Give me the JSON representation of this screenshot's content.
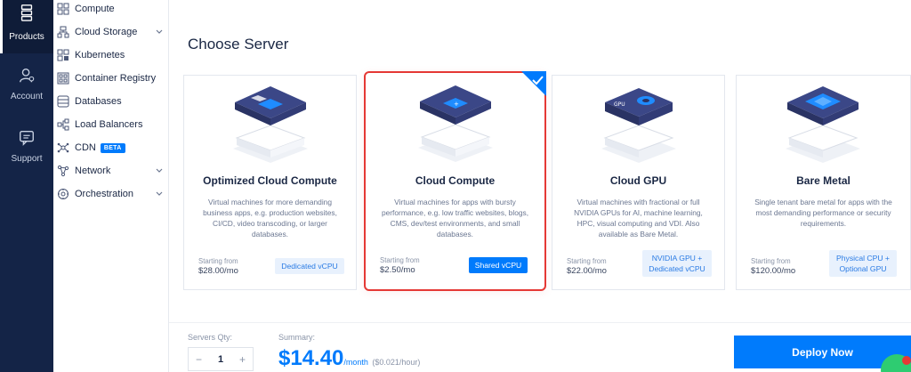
{
  "rail": {
    "items": [
      {
        "label": "Products",
        "icon": "servers-icon",
        "active": true
      },
      {
        "label": "Account",
        "icon": "user-icon",
        "active": false
      },
      {
        "label": "Support",
        "icon": "chat-icon",
        "active": false
      }
    ]
  },
  "submenu": {
    "items": [
      {
        "label": "Compute",
        "icon": "compute-icon",
        "chevron": false
      },
      {
        "label": "Cloud Storage",
        "icon": "cloud-storage-icon",
        "chevron": true
      },
      {
        "label": "Kubernetes",
        "icon": "kubernetes-icon",
        "chevron": false
      },
      {
        "label": "Container Registry",
        "icon": "container-registry-icon",
        "chevron": false
      },
      {
        "label": "Databases",
        "icon": "databases-icon",
        "chevron": false
      },
      {
        "label": "Load Balancers",
        "icon": "load-balancers-icon",
        "chevron": false
      },
      {
        "label": "CDN",
        "icon": "cdn-icon",
        "chevron": false,
        "badge": "BETA"
      },
      {
        "label": "Network",
        "icon": "network-icon",
        "chevron": true
      },
      {
        "label": "Orchestration",
        "icon": "orchestration-icon",
        "chevron": true
      }
    ]
  },
  "main": {
    "title": "Choose Server",
    "cards": [
      {
        "name": "Optimized Cloud Compute",
        "description": "Virtual machines for more demanding business apps, e.g. production websites, CI/CD, video transcoding, or larger databases.",
        "starting_from": "Starting from",
        "price": "$28.00/mo",
        "badge": "Dedicated vCPU",
        "selected": false,
        "icon": "optimized-compute-icon"
      },
      {
        "name": "Cloud Compute",
        "description": "Virtual machines for apps with bursty performance, e.g. low traffic websites, blogs, CMS, dev/test environments, and small databases.",
        "starting_from": "Starting from",
        "price": "$2.50/mo",
        "badge": "Shared vCPU",
        "selected": true,
        "icon": "cloud-compute-icon"
      },
      {
        "name": "Cloud GPU",
        "description": "Virtual machines with fractional or full NVIDIA GPUs for AI, machine learning, HPC, visual computing and VDI. Also available as Bare Metal.",
        "starting_from": "Starting from",
        "price": "$22.00/mo",
        "badge": "NVIDIA GPU + Dedicated vCPU",
        "selected": false,
        "icon": "gpu-icon"
      },
      {
        "name": "Bare Metal",
        "description": "Single tenant bare metal for apps with the most demanding performance or security requirements.",
        "starting_from": "Starting from",
        "price": "$120.00/mo",
        "badge": "Physical CPU + Optional GPU",
        "selected": false,
        "icon": "bare-metal-icon"
      }
    ]
  },
  "footer": {
    "qty_label": "Servers Qty:",
    "qty_minus": "−",
    "qty_value": "1",
    "qty_plus": "+",
    "summary_label": "Summary:",
    "summary_amount": "$14.40",
    "summary_period": "/month",
    "summary_hourly": "($0.021/hour)",
    "deploy_label": "Deploy Now"
  },
  "colors": {
    "rail_bg": "#142447",
    "accent": "#007bfc",
    "selected_border": "#e53935",
    "chat": "#2ecc71"
  }
}
